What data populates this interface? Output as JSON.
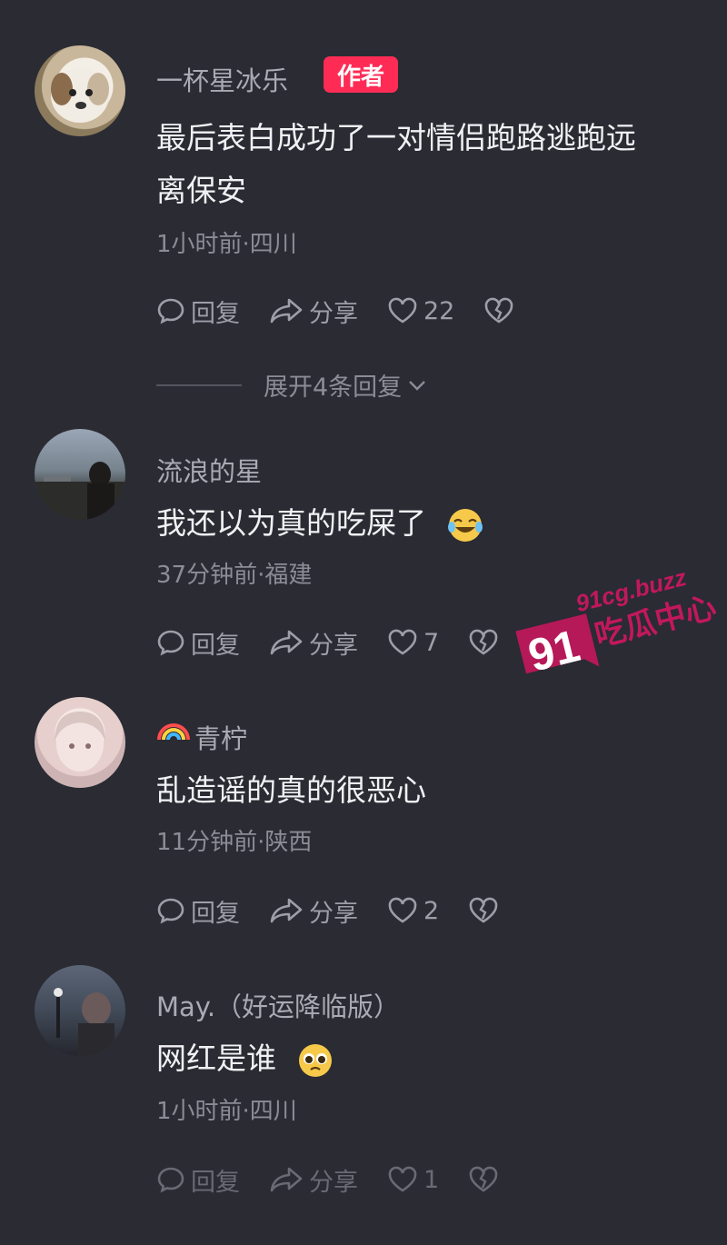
{
  "comments": [
    {
      "username": "一杯星冰乐",
      "badge": "作者",
      "text_line1": "最后表白成功了一对情侣跑路逃跑远",
      "text_line2": "离保安",
      "meta": "1小时前·四川",
      "reply_label": "回复",
      "share_label": "分享",
      "likes": "22",
      "avatar_icon": "dog-avatar"
    },
    {
      "username": "流浪的星",
      "text": "我还以为真的吃屎了",
      "emoji": "laughing-tears-emoji",
      "meta": "37分钟前·福建",
      "reply_label": "回复",
      "share_label": "分享",
      "likes": "7",
      "avatar_icon": "city-avatar"
    },
    {
      "username": "青柠",
      "username_icon": "rainbow-icon",
      "text": "乱造谣的真的很恶心",
      "meta": "11分钟前·陕西",
      "reply_label": "回复",
      "share_label": "分享",
      "likes": "2",
      "avatar_icon": "girl-avatar"
    },
    {
      "username": "May.（好运降临版）",
      "text": "网红是谁",
      "emoji": "pleading-face-emoji",
      "meta": "1小时前·四川",
      "reply_label": "回复",
      "share_label": "分享",
      "likes": "1",
      "avatar_icon": "night-avatar"
    }
  ],
  "expand_replies": "展开4条回复",
  "watermark": {
    "number": "91",
    "domain": "91cg.buzz",
    "name": "吃瓜中心"
  },
  "colors": {
    "background": "#2a2b33",
    "badge": "#fe2c55",
    "watermark": "#c2185b"
  }
}
